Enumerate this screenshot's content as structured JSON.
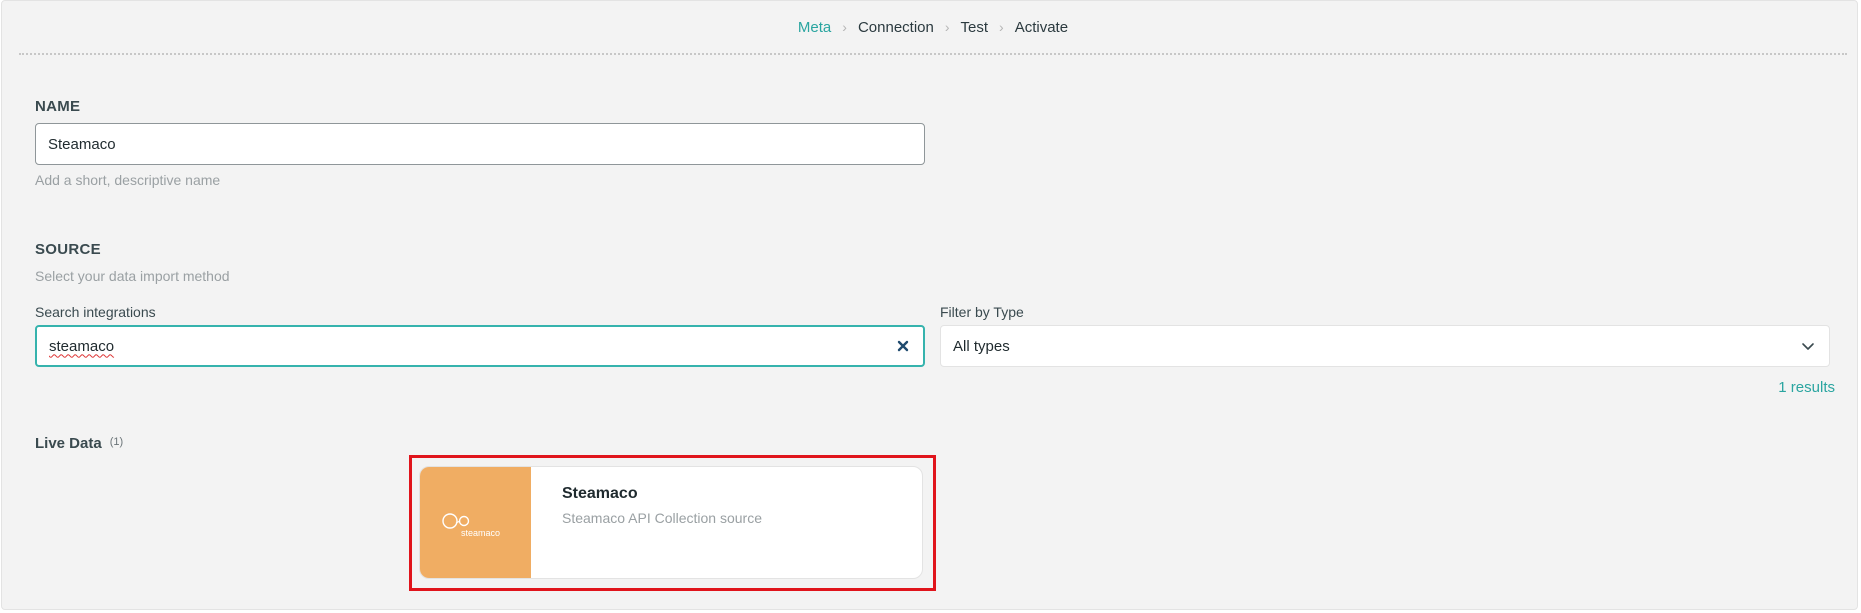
{
  "stepper": {
    "steps": [
      "Meta",
      "Connection",
      "Test",
      "Activate"
    ],
    "separator": "›",
    "active_color": "#2aa5a0"
  },
  "name_section": {
    "title": "NAME",
    "value": "Steamaco",
    "hint": "Add a short, descriptive name"
  },
  "source_section": {
    "title": "SOURCE",
    "hint": "Select your data import method",
    "search_label": "Search integrations",
    "search_value": "steamaco",
    "filter_label": "Filter by Type",
    "filter_value": "All types",
    "results_text": "1 results"
  },
  "group": {
    "title": "Live Data",
    "count": "(1)"
  },
  "integrations": [
    {
      "title": "Steamaco",
      "description": "Steamaco API Collection source",
      "logo_text": "steamaco",
      "logo_bg": "#f0ad63",
      "icon": "steamaco-logo-icon"
    }
  ],
  "colors": {
    "accent": "#2aa5a0",
    "highlight": "#e0141b",
    "panel_bg": "#f3f3f3"
  }
}
